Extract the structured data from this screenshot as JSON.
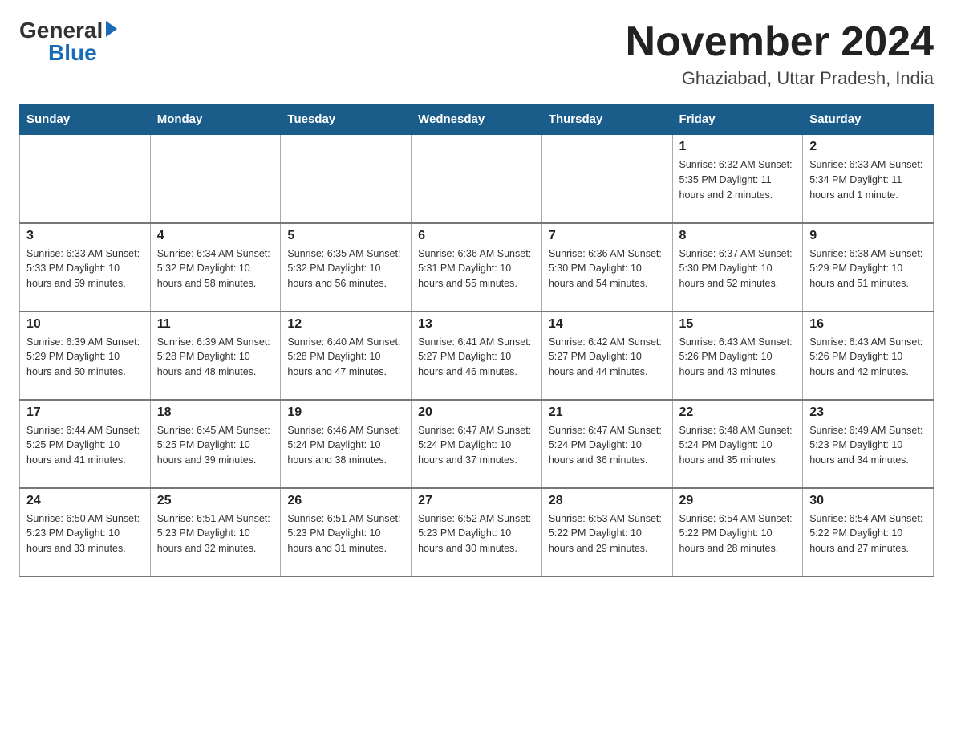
{
  "header": {
    "logo_general": "General",
    "logo_blue": "Blue",
    "title": "November 2024",
    "subtitle": "Ghaziabad, Uttar Pradesh, India"
  },
  "weekdays": [
    "Sunday",
    "Monday",
    "Tuesday",
    "Wednesday",
    "Thursday",
    "Friday",
    "Saturday"
  ],
  "weeks": [
    [
      {
        "day": "",
        "info": ""
      },
      {
        "day": "",
        "info": ""
      },
      {
        "day": "",
        "info": ""
      },
      {
        "day": "",
        "info": ""
      },
      {
        "day": "",
        "info": ""
      },
      {
        "day": "1",
        "info": "Sunrise: 6:32 AM\nSunset: 5:35 PM\nDaylight: 11 hours and 2 minutes."
      },
      {
        "day": "2",
        "info": "Sunrise: 6:33 AM\nSunset: 5:34 PM\nDaylight: 11 hours and 1 minute."
      }
    ],
    [
      {
        "day": "3",
        "info": "Sunrise: 6:33 AM\nSunset: 5:33 PM\nDaylight: 10 hours and 59 minutes."
      },
      {
        "day": "4",
        "info": "Sunrise: 6:34 AM\nSunset: 5:32 PM\nDaylight: 10 hours and 58 minutes."
      },
      {
        "day": "5",
        "info": "Sunrise: 6:35 AM\nSunset: 5:32 PM\nDaylight: 10 hours and 56 minutes."
      },
      {
        "day": "6",
        "info": "Sunrise: 6:36 AM\nSunset: 5:31 PM\nDaylight: 10 hours and 55 minutes."
      },
      {
        "day": "7",
        "info": "Sunrise: 6:36 AM\nSunset: 5:30 PM\nDaylight: 10 hours and 54 minutes."
      },
      {
        "day": "8",
        "info": "Sunrise: 6:37 AM\nSunset: 5:30 PM\nDaylight: 10 hours and 52 minutes."
      },
      {
        "day": "9",
        "info": "Sunrise: 6:38 AM\nSunset: 5:29 PM\nDaylight: 10 hours and 51 minutes."
      }
    ],
    [
      {
        "day": "10",
        "info": "Sunrise: 6:39 AM\nSunset: 5:29 PM\nDaylight: 10 hours and 50 minutes."
      },
      {
        "day": "11",
        "info": "Sunrise: 6:39 AM\nSunset: 5:28 PM\nDaylight: 10 hours and 48 minutes."
      },
      {
        "day": "12",
        "info": "Sunrise: 6:40 AM\nSunset: 5:28 PM\nDaylight: 10 hours and 47 minutes."
      },
      {
        "day": "13",
        "info": "Sunrise: 6:41 AM\nSunset: 5:27 PM\nDaylight: 10 hours and 46 minutes."
      },
      {
        "day": "14",
        "info": "Sunrise: 6:42 AM\nSunset: 5:27 PM\nDaylight: 10 hours and 44 minutes."
      },
      {
        "day": "15",
        "info": "Sunrise: 6:43 AM\nSunset: 5:26 PM\nDaylight: 10 hours and 43 minutes."
      },
      {
        "day": "16",
        "info": "Sunrise: 6:43 AM\nSunset: 5:26 PM\nDaylight: 10 hours and 42 minutes."
      }
    ],
    [
      {
        "day": "17",
        "info": "Sunrise: 6:44 AM\nSunset: 5:25 PM\nDaylight: 10 hours and 41 minutes."
      },
      {
        "day": "18",
        "info": "Sunrise: 6:45 AM\nSunset: 5:25 PM\nDaylight: 10 hours and 39 minutes."
      },
      {
        "day": "19",
        "info": "Sunrise: 6:46 AM\nSunset: 5:24 PM\nDaylight: 10 hours and 38 minutes."
      },
      {
        "day": "20",
        "info": "Sunrise: 6:47 AM\nSunset: 5:24 PM\nDaylight: 10 hours and 37 minutes."
      },
      {
        "day": "21",
        "info": "Sunrise: 6:47 AM\nSunset: 5:24 PM\nDaylight: 10 hours and 36 minutes."
      },
      {
        "day": "22",
        "info": "Sunrise: 6:48 AM\nSunset: 5:24 PM\nDaylight: 10 hours and 35 minutes."
      },
      {
        "day": "23",
        "info": "Sunrise: 6:49 AM\nSunset: 5:23 PM\nDaylight: 10 hours and 34 minutes."
      }
    ],
    [
      {
        "day": "24",
        "info": "Sunrise: 6:50 AM\nSunset: 5:23 PM\nDaylight: 10 hours and 33 minutes."
      },
      {
        "day": "25",
        "info": "Sunrise: 6:51 AM\nSunset: 5:23 PM\nDaylight: 10 hours and 32 minutes."
      },
      {
        "day": "26",
        "info": "Sunrise: 6:51 AM\nSunset: 5:23 PM\nDaylight: 10 hours and 31 minutes."
      },
      {
        "day": "27",
        "info": "Sunrise: 6:52 AM\nSunset: 5:23 PM\nDaylight: 10 hours and 30 minutes."
      },
      {
        "day": "28",
        "info": "Sunrise: 6:53 AM\nSunset: 5:22 PM\nDaylight: 10 hours and 29 minutes."
      },
      {
        "day": "29",
        "info": "Sunrise: 6:54 AM\nSunset: 5:22 PM\nDaylight: 10 hours and 28 minutes."
      },
      {
        "day": "30",
        "info": "Sunrise: 6:54 AM\nSunset: 5:22 PM\nDaylight: 10 hours and 27 minutes."
      }
    ]
  ]
}
